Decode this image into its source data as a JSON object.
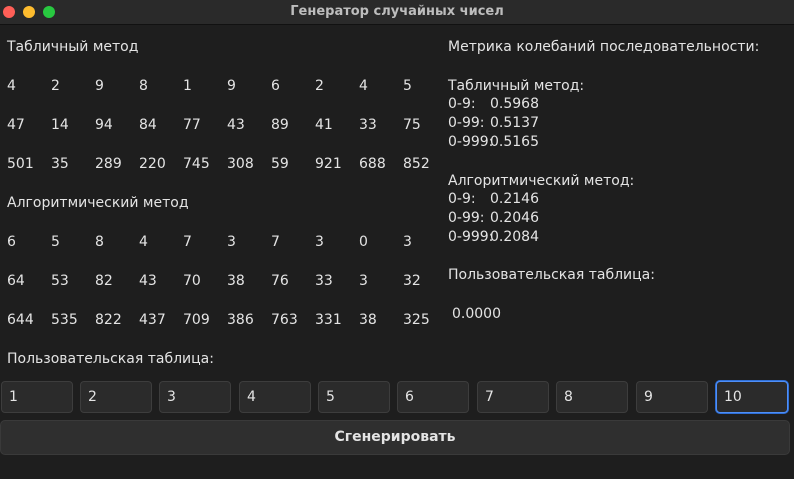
{
  "window": {
    "title": "Генератор случайных чисел"
  },
  "table_method": {
    "label": "Табличный метод",
    "rows": [
      [
        "4",
        "2",
        "9",
        "8",
        "1",
        "9",
        "6",
        "2",
        "4",
        "5"
      ],
      [
        "47",
        "14",
        "94",
        "84",
        "77",
        "43",
        "89",
        "41",
        "33",
        "75"
      ],
      [
        "501",
        "35",
        "289",
        "220",
        "745",
        "308",
        "59",
        "921",
        "688",
        "852"
      ]
    ]
  },
  "algorithmic_method": {
    "label": "Алгоритмический метод",
    "rows": [
      [
        "6",
        "5",
        "8",
        "4",
        "7",
        "3",
        "7",
        "3",
        "0",
        "3"
      ],
      [
        "64",
        "53",
        "82",
        "43",
        "70",
        "38",
        "76",
        "33",
        "3",
        "32"
      ],
      [
        "644",
        "535",
        "822",
        "437",
        "709",
        "386",
        "763",
        "331",
        "38",
        "325"
      ]
    ]
  },
  "metrics": {
    "title": "Метрика колебаний последовательности:",
    "table": {
      "label": "Табличный метод:",
      "lines": [
        {
          "range": "0-9:",
          "value": "0.5968"
        },
        {
          "range": "0-99:",
          "value": "0.5137"
        },
        {
          "range": "0-999:",
          "value": "0.5165"
        }
      ]
    },
    "algorithmic": {
      "label": "Алгоритмический метод:",
      "lines": [
        {
          "range": "0-9:",
          "value": "0.2146"
        },
        {
          "range": "0-99:",
          "value": "0.2046"
        },
        {
          "range": "0-999:",
          "value": "0.2084"
        }
      ]
    },
    "custom": {
      "label": "Пользовательская таблица:",
      "value": "0.0000"
    }
  },
  "custom_table": {
    "label": "Пользовательская таблица:",
    "inputs": [
      "1",
      "2",
      "3",
      "4",
      "5",
      "6",
      "7",
      "8",
      "9",
      "10"
    ],
    "focused_index": 9
  },
  "generate_button": {
    "label": "Сгенерировать"
  },
  "colors": {
    "background": "#1e1e1e",
    "focus_border": "#4f8ff7",
    "close": "#ff5f57",
    "minimize": "#febc2e",
    "maximize": "#28c840"
  }
}
